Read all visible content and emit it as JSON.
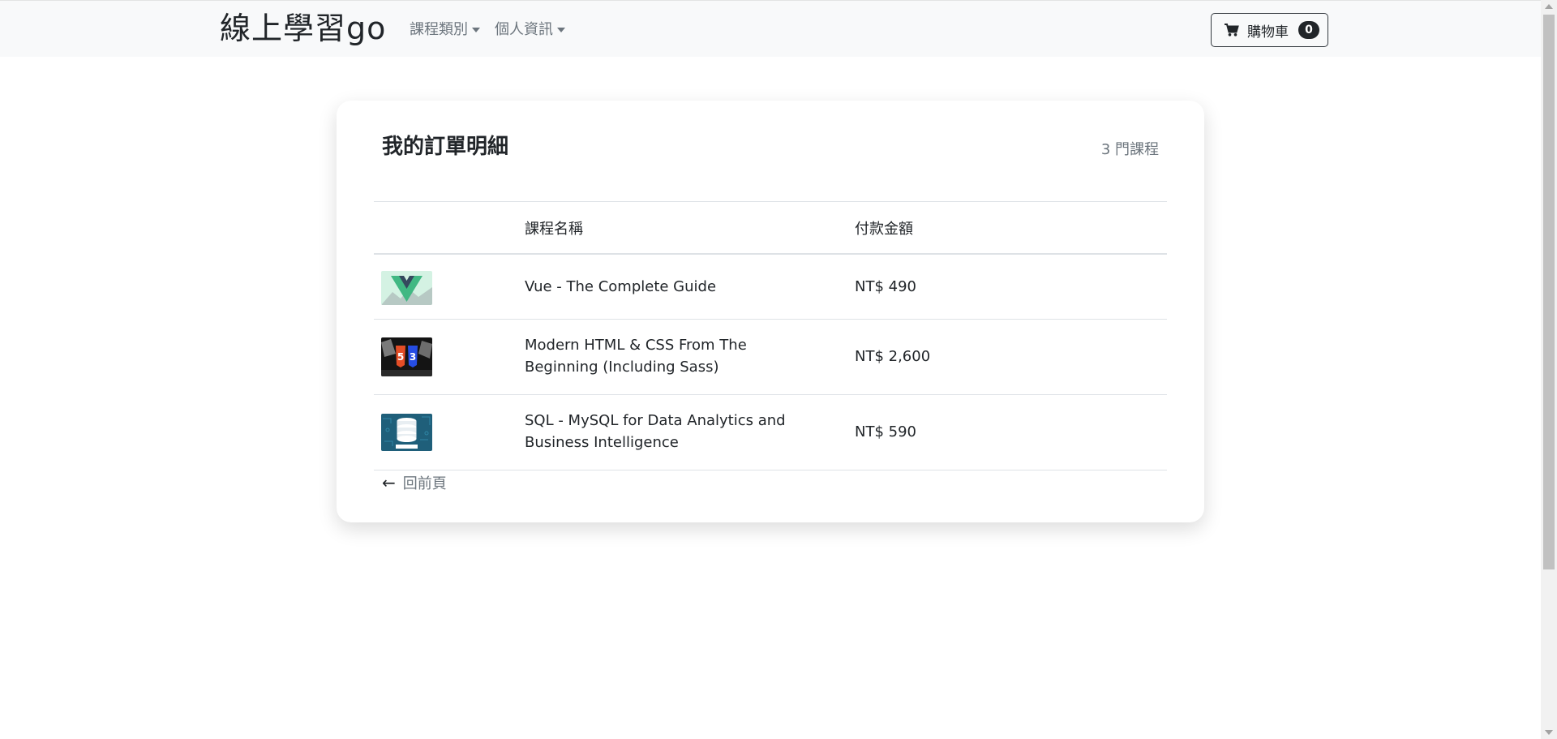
{
  "navbar": {
    "brand": "線上學習go",
    "menus": [
      {
        "label": "課程類別"
      },
      {
        "label": "個人資訊"
      }
    ],
    "cart": {
      "label": "購物車",
      "count": "0"
    }
  },
  "order": {
    "title": "我的訂單明細",
    "count_text": "3 門課程",
    "columns": {
      "name": "課程名稱",
      "price": "付款金額"
    },
    "items": [
      {
        "name": "Vue - The Complete Guide",
        "price": "NT$ 490",
        "thumb_icon": "vue-logo-icon"
      },
      {
        "name": "Modern HTML & CSS From The Beginning (Including Sass)",
        "price": "NT$ 2,600",
        "thumb_icon": "css3-logo-icon"
      },
      {
        "name": "SQL - MySQL for Data Analytics and Business Intelligence",
        "price": "NT$ 590",
        "thumb_icon": "database-icon"
      }
    ],
    "back": {
      "arrow": "←",
      "label": "回前頁"
    }
  },
  "colors": {
    "navbar_bg": "#f8f9fa",
    "muted_text": "#6c757d",
    "dark": "#212529"
  }
}
